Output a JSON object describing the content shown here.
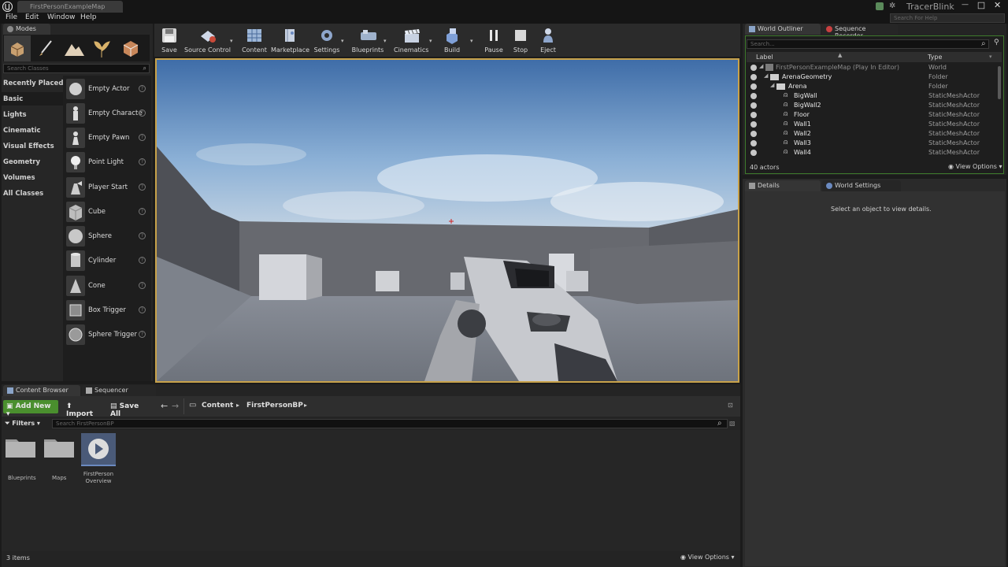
{
  "window": {
    "doc_tab": "FirstPersonExampleMap",
    "project_name": "TracerBlink",
    "search_help_placeholder": "Search For Help"
  },
  "menu": [
    "File",
    "Edit",
    "Window",
    "Help"
  ],
  "modes": {
    "tab_label": "Modes",
    "search_placeholder": "Search Classes",
    "categories": [
      "Recently Placed",
      "Basic",
      "Lights",
      "Cinematic",
      "Visual Effects",
      "Geometry",
      "Volumes",
      "All Classes"
    ],
    "selected_category": "Basic",
    "items": [
      "Empty Actor",
      "Empty Characte",
      "Empty Pawn",
      "Point Light",
      "Player Start",
      "Cube",
      "Sphere",
      "Cylinder",
      "Cone",
      "Box Trigger",
      "Sphere Trigger"
    ]
  },
  "toolbar": {
    "save": "Save",
    "source_control": "Source Control",
    "content": "Content",
    "marketplace": "Marketplace",
    "settings": "Settings",
    "blueprints": "Blueprints",
    "cinematics": "Cinematics",
    "build": "Build",
    "pause": "Pause",
    "stop": "Stop",
    "eject": "Eject"
  },
  "outliner": {
    "tab_outliner": "World Outliner",
    "tab_sequence": "Sequence Recorder",
    "search_placeholder": "Search...",
    "col_label": "Label",
    "col_type": "Type",
    "rows": [
      {
        "label": "FirstPersonExampleMap (Play In Editor)",
        "type": "World"
      },
      {
        "label": "ArenaGeometry",
        "type": "Folder"
      },
      {
        "label": "Arena",
        "type": "Folder"
      },
      {
        "label": "BigWall",
        "type": "StaticMeshActor"
      },
      {
        "label": "BigWall2",
        "type": "StaticMeshActor"
      },
      {
        "label": "Floor",
        "type": "StaticMeshActor"
      },
      {
        "label": "Wall1",
        "type": "StaticMeshActor"
      },
      {
        "label": "Wall2",
        "type": "StaticMeshActor"
      },
      {
        "label": "Wall3",
        "type": "StaticMeshActor"
      },
      {
        "label": "Wall4",
        "type": "StaticMeshActor"
      }
    ],
    "actor_count": "40 actors",
    "view_options": "View Options"
  },
  "details": {
    "tab_details": "Details",
    "tab_world_settings": "World Settings",
    "empty_message": "Select an object to view details."
  },
  "content_browser": {
    "tab_content": "Content Browser",
    "tab_sequencer": "Sequencer",
    "add_new": "Add New",
    "import": "Import",
    "save_all": "Save All",
    "path": [
      "Content",
      "FirstPersonBP"
    ],
    "filters": "Filters",
    "search_placeholder": "Search FirstPersonBP",
    "assets": [
      "Blueprints",
      "Maps",
      "FirstPerson Overview"
    ],
    "item_count": "3 items",
    "view_options": "View Options"
  },
  "colors": {
    "accent_green": "#4a8f2e",
    "viewport_border": "#c8a24a",
    "outliner_border": "#3e7a2c"
  }
}
